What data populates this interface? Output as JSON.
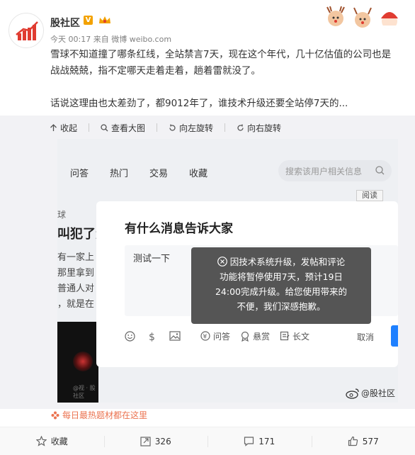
{
  "author": {
    "name": "股社区",
    "time": "今天 00:17",
    "source_prefix": "来自",
    "source": "微博 weibo.com"
  },
  "post": {
    "lines": [
      "雪球不知道撞了哪条红线，全站禁言7天，现在这个年代，几十亿估值的公司也是",
      "战战兢兢，指不定哪天走着走着，趟着雷就没了。",
      "",
      "话说这理由也太差劲了，都9012年了，谁技术升级还要全站停7天的..."
    ]
  },
  "media_bar": {
    "collapse": "收起",
    "view_large": "查看大图",
    "rotate_left": "向左旋转",
    "rotate_right": "向右旋转"
  },
  "screenshot": {
    "nav": [
      "问答",
      "热门",
      "交易",
      "收藏"
    ],
    "search_placeholder": "搜索该用户相关信息",
    "read_button": "阅读",
    "left_tag": "球",
    "left_title": "叫犯了众",
    "left_lines": [
      "有一家上",
      "那里拿到",
      "普通人对",
      "，就是在"
    ],
    "dark_caption": "@视 · 股社区",
    "modal": {
      "title": "有什么消息告诉大家",
      "draft": "测试一下",
      "tools": [
        "问答",
        "悬赏",
        "长文"
      ],
      "cancel": "取消"
    },
    "toast": {
      "lines": [
        "因技术系统升级，发帖和评论",
        "功能将暂停使用7天，预计19日",
        "24:00完成升级。给您使用带来的",
        "不便，我们深感抱歉。"
      ]
    }
  },
  "watermark": "@股社区",
  "hot_topic": "每日最热题材都在这里",
  "actions": {
    "favorite": "收藏",
    "repost": "326",
    "comment": "171",
    "like": "577"
  },
  "colors": {
    "brand_orange": "#eb7350",
    "submit_blue": "#1e80ff",
    "vip_gold": "#f3a200"
  }
}
